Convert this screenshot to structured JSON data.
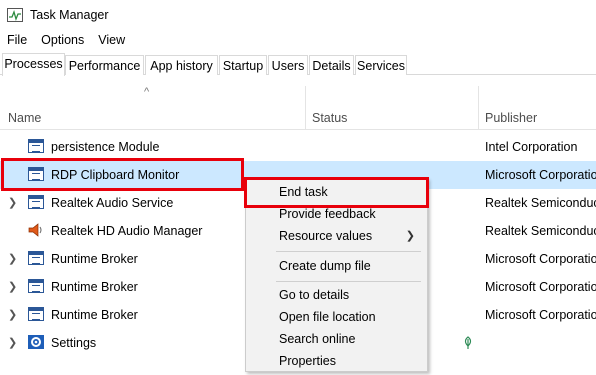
{
  "window": {
    "title": "Task Manager"
  },
  "menu": [
    "File",
    "Options",
    "View"
  ],
  "tabs": [
    "Processes",
    "Performance",
    "App history",
    "Startup",
    "Users",
    "Details",
    "Services"
  ],
  "columns": {
    "sort_indicator": "^",
    "name": "Name",
    "status": "Status",
    "publisher": "Publisher"
  },
  "rows": [
    {
      "name": "persistence Module",
      "publisher": "Intel Corporation",
      "icon": "window-icon"
    },
    {
      "name": "RDP Clipboard Monitor",
      "publisher": "Microsoft Corporation",
      "icon": "window-icon",
      "selected": true
    },
    {
      "name": "Realtek Audio Service",
      "publisher": "Realtek Semiconductor",
      "icon": "window-icon"
    },
    {
      "name": "Realtek HD Audio Manager",
      "publisher": "Realtek Semiconductor",
      "icon": "speaker-icon"
    },
    {
      "name": "Runtime Broker",
      "publisher": "Microsoft Corporation",
      "icon": "window-icon"
    },
    {
      "name": "Runtime Broker",
      "publisher": "Microsoft Corporation",
      "icon": "window-icon"
    },
    {
      "name": "Runtime Broker",
      "publisher": "Microsoft Corporation",
      "icon": "window-icon"
    },
    {
      "name": "Settings",
      "publisher": "",
      "icon": "gear-icon",
      "status_icon": "leaf-icon"
    }
  ],
  "context_menu": {
    "end_task": "End task",
    "provide_feedback": "Provide feedback",
    "resource_values": "Resource values",
    "create_dump_file": "Create dump file",
    "go_to_details": "Go to details",
    "open_file_location": "Open file location",
    "search_online": "Search online",
    "properties": "Properties"
  },
  "colors": {
    "selection": "#cce8ff",
    "highlight_outline": "#e8000b",
    "accent": "#2b5797"
  }
}
